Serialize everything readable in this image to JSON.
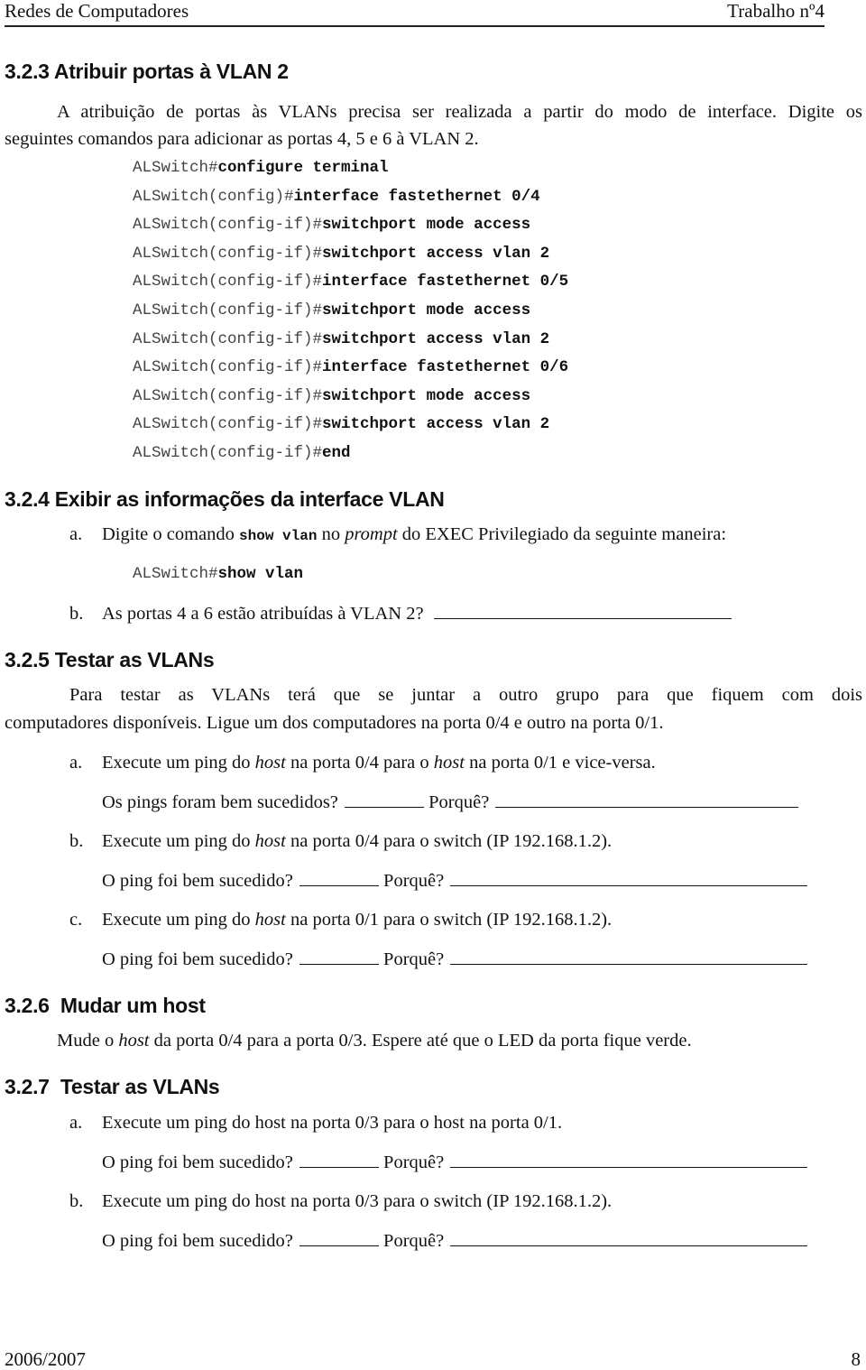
{
  "header": {
    "course": "Redes de Computadores",
    "assignment": "Trabalho nº4"
  },
  "sections": {
    "s323": {
      "title": "3.2.3 Atribuir portas à VLAN 2",
      "intro_line1": "A atribuição de portas às VLANs precisa ser realizada a partir do modo de interface. Digite os",
      "intro_line2": "seguintes comandos para adicionar as portas 4, 5 e 6 à VLAN 2.",
      "commands": [
        {
          "prompt": "ALSwitch#",
          "cmd": "configure terminal"
        },
        {
          "prompt": "ALSwitch(config)#",
          "cmd": "interface fastethernet 0/4"
        },
        {
          "prompt": "ALSwitch(config-if)#",
          "cmd": "switchport mode access"
        },
        {
          "prompt": "ALSwitch(config-if)#",
          "cmd": "switchport access vlan 2"
        },
        {
          "prompt": "ALSwitch(config-if)#",
          "cmd": "interface fastethernet 0/5"
        },
        {
          "prompt": "ALSwitch(config-if)#",
          "cmd": "switchport mode access"
        },
        {
          "prompt": "ALSwitch(config-if)#",
          "cmd": "switchport access vlan 2"
        },
        {
          "prompt": "ALSwitch(config-if)#",
          "cmd": "interface fastethernet 0/6"
        },
        {
          "prompt": "ALSwitch(config-if)#",
          "cmd": "switchport mode access"
        },
        {
          "prompt": "ALSwitch(config-if)#",
          "cmd": "switchport access vlan 2"
        },
        {
          "prompt": "ALSwitch(config-if)#",
          "cmd": "end"
        }
      ]
    },
    "s324": {
      "title": "3.2.4 Exibir as informações da interface VLAN",
      "a_label": "a.",
      "a_text_1": "Digite o comando ",
      "a_code": "show vlan",
      "a_text_2": " no ",
      "a_italic": "prompt",
      "a_text_3": " do EXEC Privilegiado da seguinte maneira:",
      "command": {
        "prompt": "ALSwitch#",
        "cmd": "show vlan"
      },
      "b_label": "b.",
      "b_text": "As portas 4 a 6 estão atribuídas à VLAN 2?"
    },
    "s325": {
      "title": "3.2.5 Testar as VLANs",
      "intro_line1": "Para testar as VLANs terá que se juntar a outro grupo para que fiquem com dois",
      "intro_line2": "computadores disponíveis. Ligue um dos computadores na porta 0/4 e outro na porta 0/1.",
      "items": [
        {
          "label": "a.",
          "t1": "Execute um ping do ",
          "i1": "host",
          "t2": " na porta 0/4 para o ",
          "i2": "host",
          "t3": " na porta 0/1 e vice-versa.",
          "question": "Os pings foram bem sucedidos?",
          "why": "Porquê?"
        },
        {
          "label": "b.",
          "t1": "Execute um ping do ",
          "i1": "host",
          "t2": " na porta 0/4 para o switch (IP 192.168.1.2).",
          "question": "O ping foi bem sucedido?",
          "why": "Porquê?"
        },
        {
          "label": "c.",
          "t1": "Execute um ping do ",
          "i1": "host",
          "t2": " na porta 0/1 para o switch (IP 192.168.1.2).",
          "question": "O ping foi bem sucedido?",
          "why": "Porquê?"
        }
      ]
    },
    "s326": {
      "title": "3.2.6  Mudar um host",
      "t1": "Mude o ",
      "i1": "host",
      "t2": " da porta 0/4 para a porta 0/3. Espere até que o LED da porta fique verde."
    },
    "s327": {
      "title": "3.2.7  Testar as VLANs",
      "items": [
        {
          "label": "a.",
          "text": "Execute um ping do host na porta 0/3 para o host na porta 0/1.",
          "question": "O ping foi bem sucedido?",
          "why": "Porquê?"
        },
        {
          "label": "b.",
          "text": "Execute um ping do host na porta 0/3 para o switch (IP 192.168.1.2).",
          "question": "O ping foi bem sucedido?",
          "why": "Porquê?"
        }
      ]
    }
  },
  "footer": {
    "year": "2006/2007",
    "page": "8"
  }
}
